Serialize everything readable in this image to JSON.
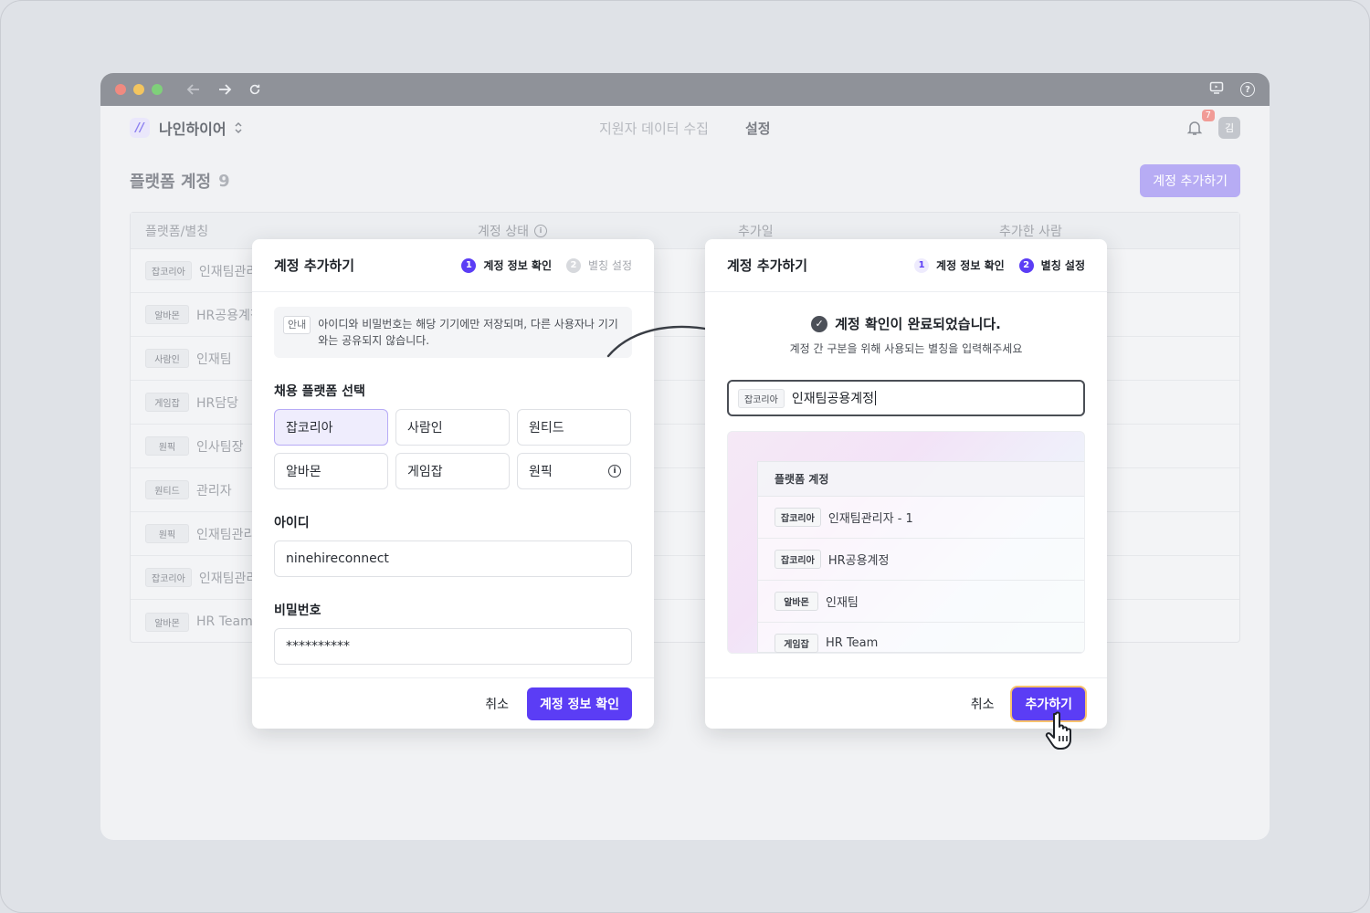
{
  "app": {
    "brand": "나인하이어",
    "nav": [
      {
        "label": "지원자 데이터 수집"
      },
      {
        "label": "설정"
      }
    ],
    "notification_count": "7",
    "avatar_initial": "김"
  },
  "page": {
    "title": "플랫폼 계정",
    "count": "9",
    "add_button": "계정 추가하기"
  },
  "table": {
    "columns": [
      "플랫폼/별칭",
      "계정 상태",
      "추가일",
      "추가한 사람"
    ],
    "rows": [
      {
        "platform": "잡코리아",
        "alias": "인재팀관리"
      },
      {
        "platform": "알바몬",
        "alias": "HR공용계정"
      },
      {
        "platform": "사람인",
        "alias": "인재팀"
      },
      {
        "platform": "게임잡",
        "alias": "HR담당"
      },
      {
        "platform": "원픽",
        "alias": "인사팀장"
      },
      {
        "platform": "원티드",
        "alias": "관리자"
      },
      {
        "platform": "원픽",
        "alias": "인재팀관리"
      },
      {
        "platform": "잡코리아",
        "alias": "인재팀관리"
      },
      {
        "platform": "알바몬",
        "alias": "HR Team"
      }
    ]
  },
  "modal_left": {
    "title": "계정 추가하기",
    "step1": "계정 정보 확인",
    "step2": "별칭 설정",
    "notice_tag": "안내",
    "notice_text": "아이디와 비밀번호는 해당 기기에만 저장되며, 다른 사용자나 기기와는 공유되지 않습니다.",
    "platform_label": "채용 플랫폼 선택",
    "platforms": [
      "잡코리아",
      "사람인",
      "원티드",
      "알바몬",
      "게임잡",
      "원픽"
    ],
    "selected_platform": "잡코리아",
    "id_label": "아이디",
    "id_value": "ninehireconnect",
    "pw_label": "비밀번호",
    "pw_value": "**********",
    "cancel": "취소",
    "confirm": "계정 정보 확인"
  },
  "modal_right": {
    "title": "계정 추가하기",
    "step1": "계정 정보 확인",
    "step2": "별칭 설정",
    "done_title": "계정 확인이 완료되었습니다.",
    "done_sub": "계정 간 구분을 위해 사용되는 별칭을 입력해주세요",
    "alias_tag": "잡코리아",
    "alias_value": "인재팀공용계정",
    "preview_title": "플랫폼 계정",
    "preview_rows": [
      {
        "platform": "잡코리아",
        "alias": "인재팀관리자 - 1"
      },
      {
        "platform": "잡코리아",
        "alias": "HR공용계정"
      },
      {
        "platform": "알바몬",
        "alias": "인재팀"
      },
      {
        "platform": "게임잡",
        "alias": "HR Team"
      }
    ],
    "cancel": "취소",
    "submit": "추가하기"
  },
  "colors": {
    "primary": "#5b3df5",
    "primary_disabled": "#b7acf4",
    "focus_ring": "#f7c26c"
  }
}
